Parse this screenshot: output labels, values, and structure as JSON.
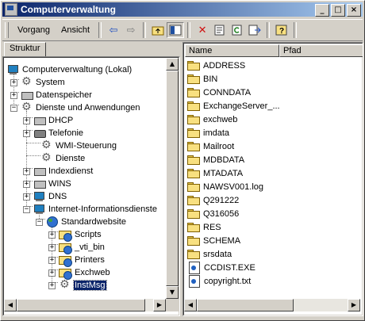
{
  "window": {
    "title": "Computerverwaltung"
  },
  "toolbar": {
    "menu_vorgang": "Vorgang",
    "menu_ansicht": "Ansicht"
  },
  "left_tab": {
    "label": "Struktur"
  },
  "tree": {
    "root": "Computerverwaltung (Lokal)",
    "system": "System",
    "datenspeicher": "Datenspeicher",
    "dienste_und_anwendungen": "Dienste und Anwendungen",
    "dhcp": "DHCP",
    "telefonie": "Telefonie",
    "wmi": "WMI-Steuerung",
    "dienste": "Dienste",
    "indexdienst": "Indexdienst",
    "wins": "WINS",
    "dns": "DNS",
    "iis": "Internet-Informationsdienste",
    "standardwebsite": "Standardwebsite",
    "scripts": "Scripts",
    "vti_bin": "_vti_bin",
    "printers": "Printers",
    "exchweb": "Exchweb",
    "instmsg": "InstMsg"
  },
  "list": {
    "col_name": "Name",
    "col_pfad": "Pfad",
    "items": [
      {
        "name": "ADDRESS",
        "type": "folder"
      },
      {
        "name": "BIN",
        "type": "folder"
      },
      {
        "name": "CONNDATA",
        "type": "folder"
      },
      {
        "name": "ExchangeServer_...",
        "type": "folder"
      },
      {
        "name": "exchweb",
        "type": "folder"
      },
      {
        "name": "imdata",
        "type": "folder"
      },
      {
        "name": "Mailroot",
        "type": "folder"
      },
      {
        "name": "MDBDATA",
        "type": "folder"
      },
      {
        "name": "MTADATA",
        "type": "folder"
      },
      {
        "name": "NAWSV001.log",
        "type": "folder"
      },
      {
        "name": "Q291222",
        "type": "folder"
      },
      {
        "name": "Q316056",
        "type": "folder"
      },
      {
        "name": "RES",
        "type": "folder"
      },
      {
        "name": "SCHEMA",
        "type": "folder"
      },
      {
        "name": "srsdata",
        "type": "folder"
      },
      {
        "name": "CCDIST.EXE",
        "type": "file"
      },
      {
        "name": "copyright.txt",
        "type": "file"
      }
    ]
  }
}
